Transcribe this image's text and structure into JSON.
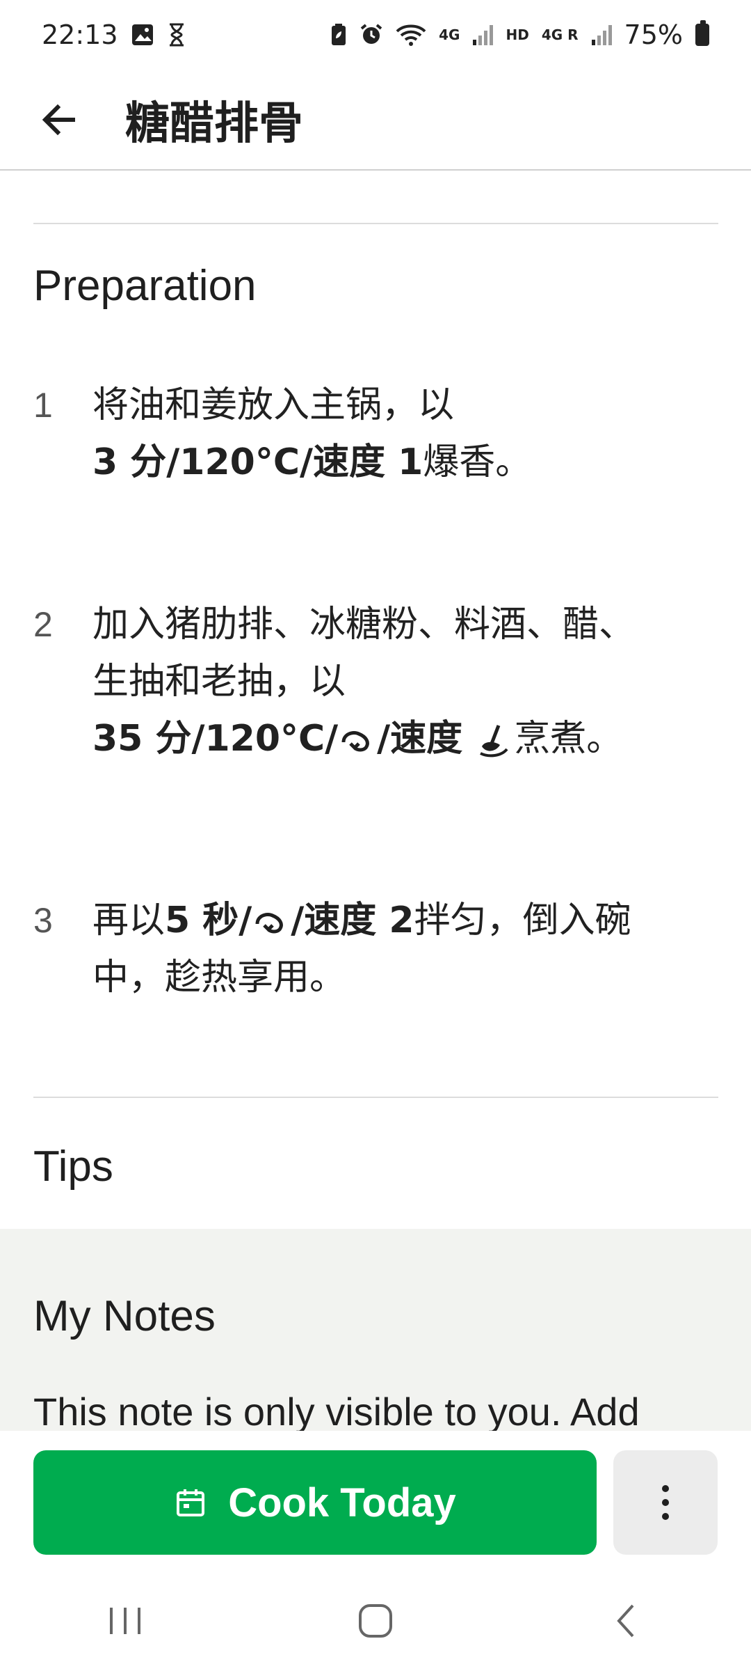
{
  "status_bar": {
    "time": "22:13",
    "net1": "4G",
    "hd": "HD",
    "net2": "4G R",
    "battery": "75%",
    "icons": [
      "image-icon",
      "hourglass-icon",
      "battery-saver-icon",
      "alarm-icon",
      "wifi-icon",
      "signal-icon",
      "battery-icon"
    ]
  },
  "header": {
    "title": "糖醋排骨",
    "back_icon": "arrow-left-icon"
  },
  "preparation": {
    "title": "Preparation",
    "steps": [
      {
        "num": "1",
        "line1": "将油和姜放入主锅，以",
        "bold": "3 分/120°C/速度 1",
        "rest": "爆香。"
      },
      {
        "num": "2",
        "line1": "加入猪肋排、冰糖粉、料酒、醋、",
        "line2": "生抽和老抽，以",
        "bold_a": "35 分/120°C/",
        "bold_b": "/速度 ",
        "rest": "烹煮。"
      },
      {
        "num": "3",
        "prefix": "再以",
        "bold_a": "5 秒/",
        "bold_b": "/速度 2",
        "rest": "拌匀，倒入碗",
        "line2": "中，趁热享用。"
      }
    ]
  },
  "tips": {
    "title": "Tips"
  },
  "notes": {
    "title": "My Notes",
    "text": "This note is only visible to you. Add"
  },
  "actions": {
    "cook_label": "Cook Today",
    "cook_icon": "calendar-icon",
    "more_icon": "more-vertical-icon"
  },
  "colors": {
    "primary": "#00ac4f",
    "notes_bg": "#f2f3f0",
    "divider": "#dcdcdc"
  }
}
